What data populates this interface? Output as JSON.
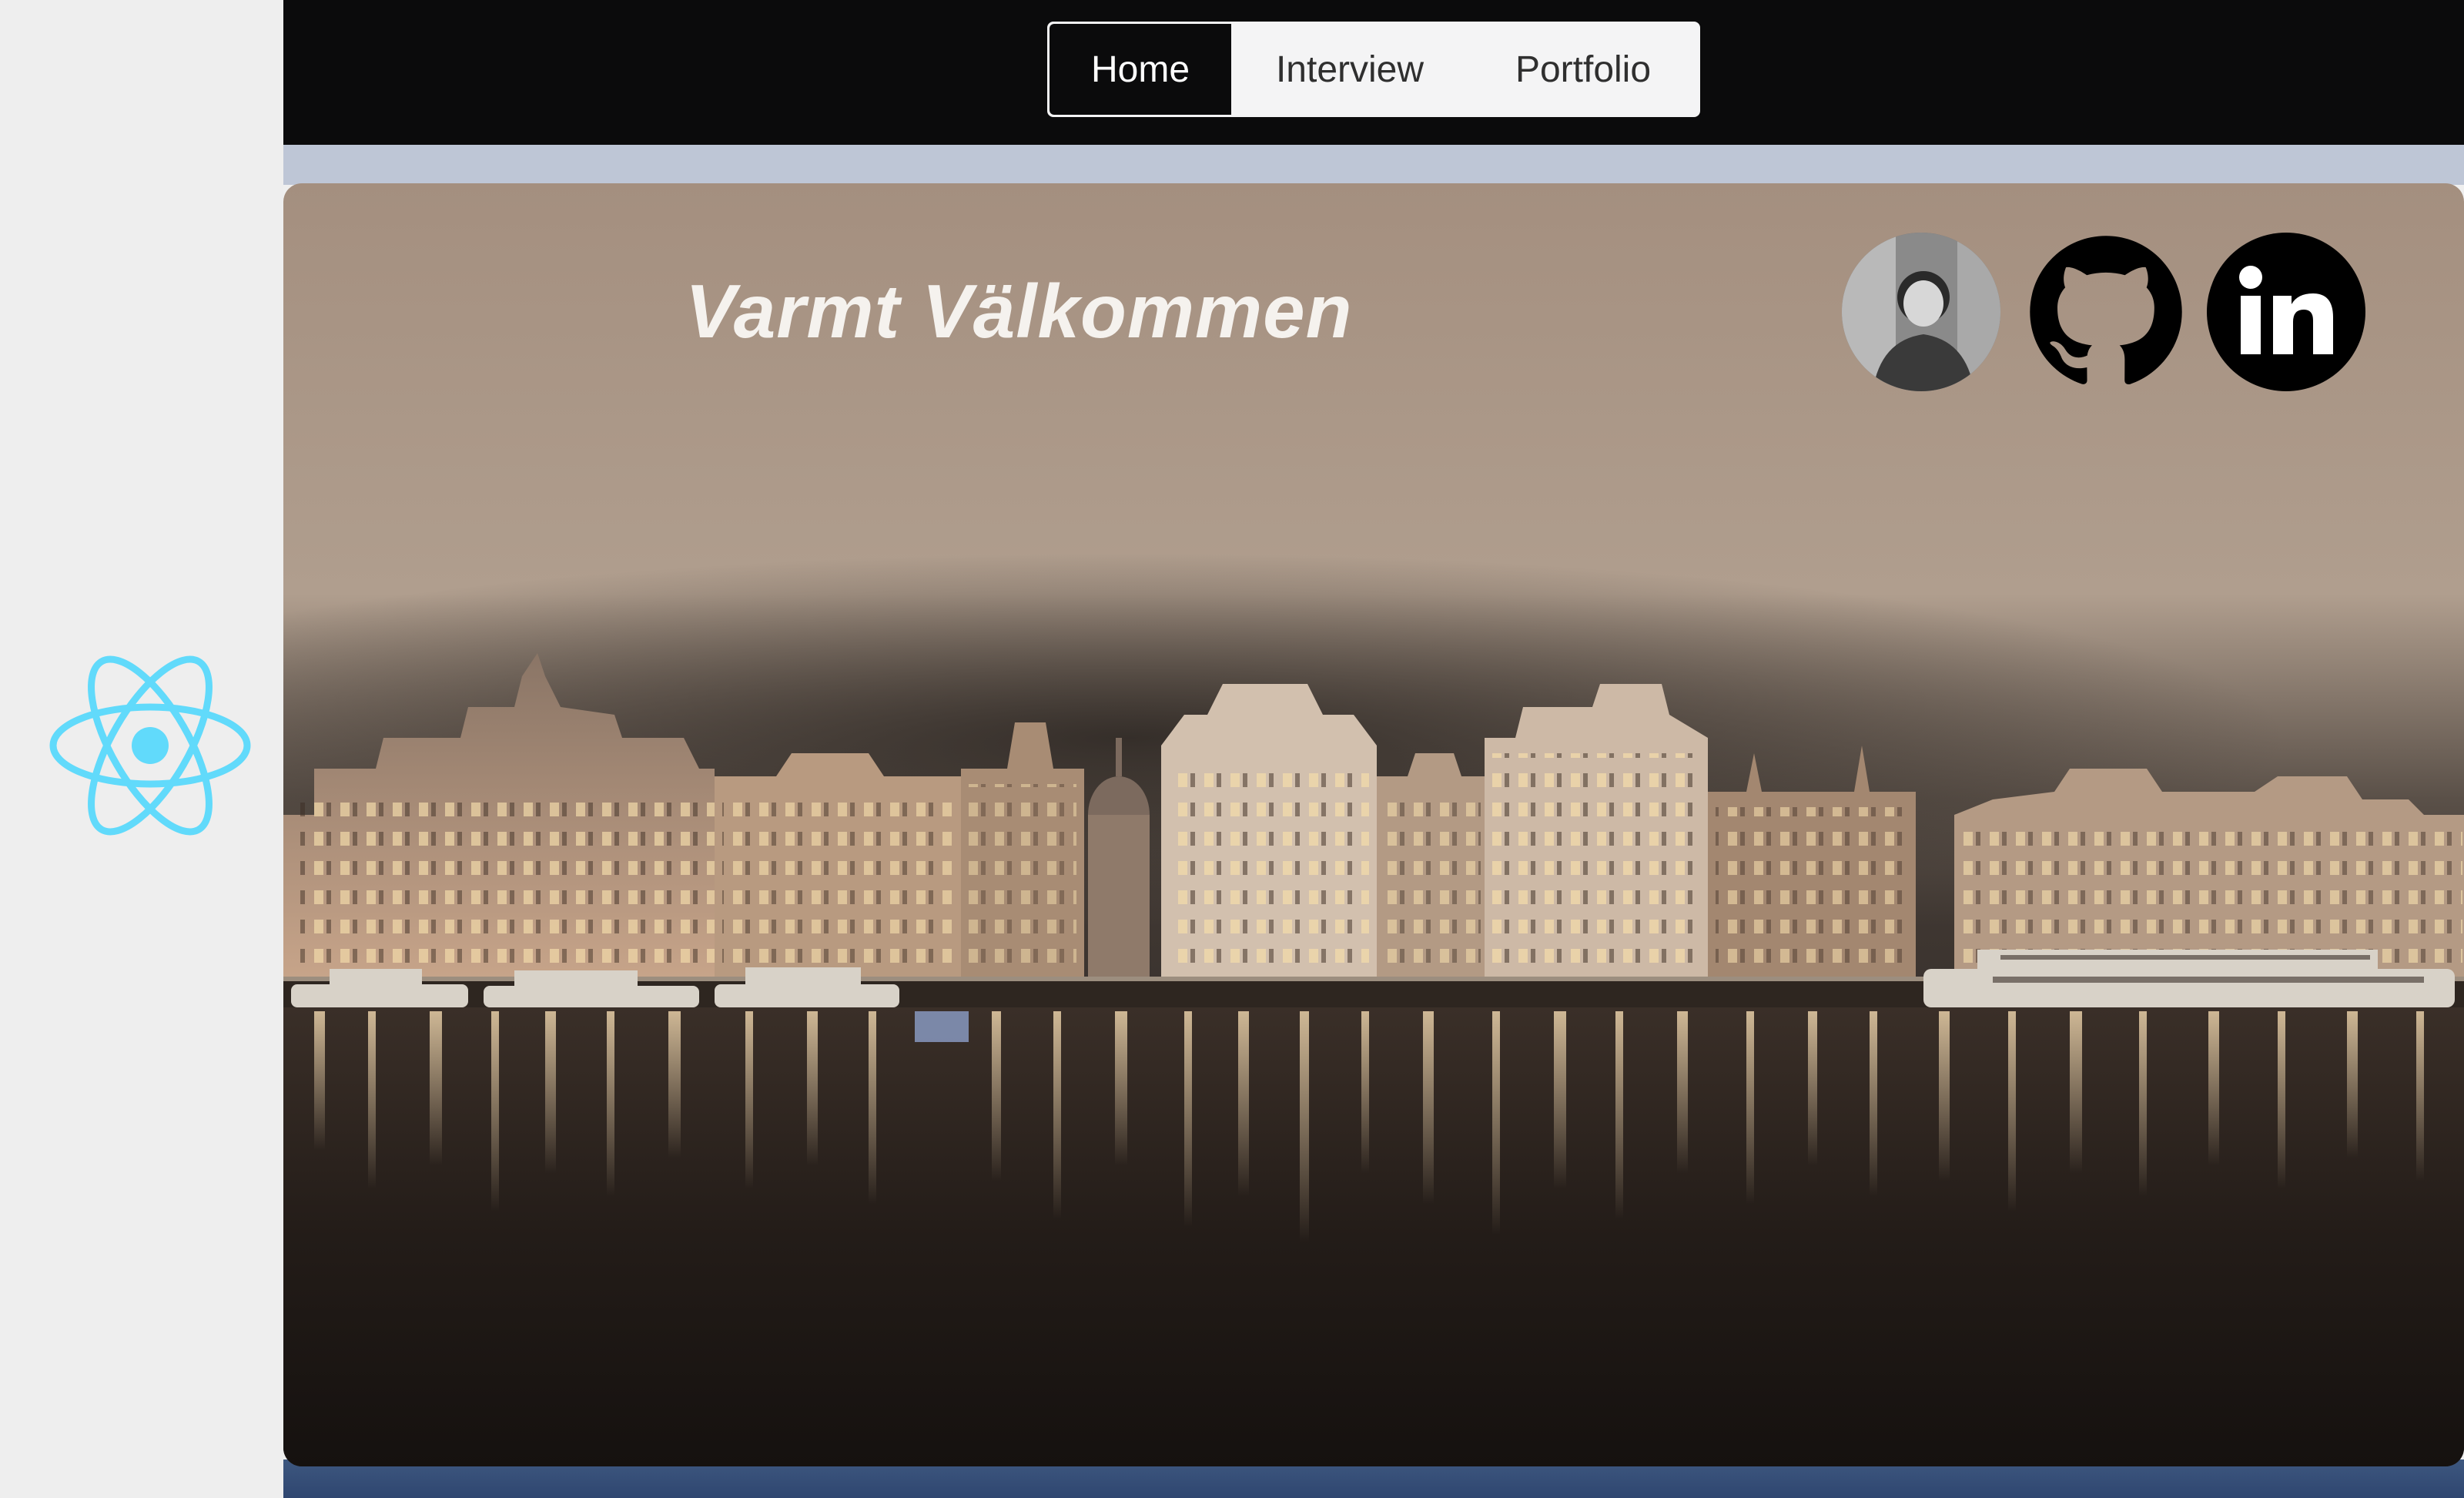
{
  "nav": {
    "items": [
      {
        "label": "Home",
        "active": true
      },
      {
        "label": "Interview",
        "active": false
      },
      {
        "label": "Portfolio",
        "active": false
      }
    ]
  },
  "hero": {
    "title": "Varmt Välkommen"
  },
  "social": {
    "avatar_icon": "profile-avatar",
    "github_icon": "github-icon",
    "linkedin_icon": "linkedin-icon",
    "linkedin_text": "in"
  },
  "colors": {
    "topbar": "#0b0b0c",
    "sidebar": "#eeeeee",
    "react_blue": "#61dafb",
    "strip": "#bec6d6"
  }
}
